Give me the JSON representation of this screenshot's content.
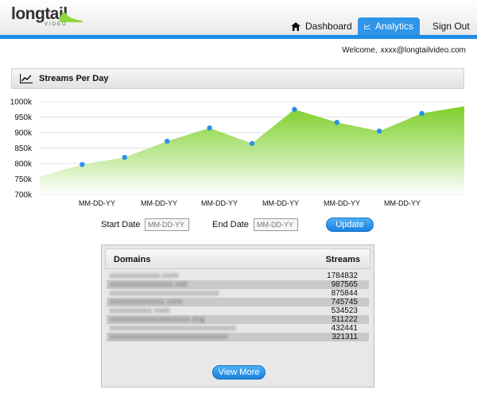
{
  "header": {
    "logo_text": "longtail",
    "logo_sub": "VIDEO",
    "nav": [
      {
        "label": "Dashboard",
        "icon": "home-icon",
        "active": false
      },
      {
        "label": "Analytics",
        "icon": "line-chart-icon",
        "active": true
      },
      {
        "label": "Sign Out",
        "active": false
      }
    ],
    "accent_color": "#1e8ce6"
  },
  "welcome": {
    "prefix": "Welcome,",
    "email": "xxxx@longtailvideo.com"
  },
  "panel": {
    "title": "Streams Per Day",
    "icon": "line-chart-icon"
  },
  "chart_data": {
    "type": "area",
    "title": "Streams Per Day",
    "x_tick_labels": [
      "MM-DD-YY",
      "MM-DD-YY",
      "MM-DD-YY",
      "MM-DD-YY",
      "MM-DD-YY",
      "MM-DD-YY"
    ],
    "y_tick_labels": [
      "1000k",
      "950k",
      "900k",
      "850k",
      "800k",
      "750k",
      "700k"
    ],
    "ylim": [
      700000,
      1000000
    ],
    "grid": true,
    "fill_color": "#8fd63c",
    "point_color": "#2a8fe8",
    "values": [
      758000,
      797000,
      820000,
      872000,
      915000,
      865000,
      975000,
      933000,
      905000,
      962000,
      985000
    ],
    "markers": [
      false,
      true,
      true,
      true,
      true,
      true,
      true,
      true,
      true,
      true,
      false
    ]
  },
  "filters": {
    "start_label": "Start Date",
    "start_placeholder": "MM-DD-YY",
    "end_label": "End Date",
    "end_placeholder": "MM-DD-YY",
    "update_label": "Update"
  },
  "table": {
    "col_domain": "Domains",
    "col_streams": "Streams",
    "rows": [
      {
        "domain": "xxxxxxxxxxxx.com",
        "streams": "1784832"
      },
      {
        "domain": "xxxxxxxxxxxxxxx.net",
        "streams": "987565"
      },
      {
        "domain": "xxxxxxxxxxxxxxxxxxxxxxxxxx",
        "streams": "875844"
      },
      {
        "domain": "xxxxxxxxxxxxx.com",
        "streams": "745745"
      },
      {
        "domain": "xxxxxxxxxx.com",
        "streams": "534523"
      },
      {
        "domain": "xxxxxxxxxxxxxxxxxxx.org",
        "streams": "511222"
      },
      {
        "domain": "xxxxxxxxxxxxxxxxxxxxxxxxxxxxxx",
        "streams": "432441"
      },
      {
        "domain": "xxxxxxxxxxxxxxxxxxxxxxxxxxxx",
        "streams": "321311"
      }
    ],
    "view_more_label": "View More"
  }
}
